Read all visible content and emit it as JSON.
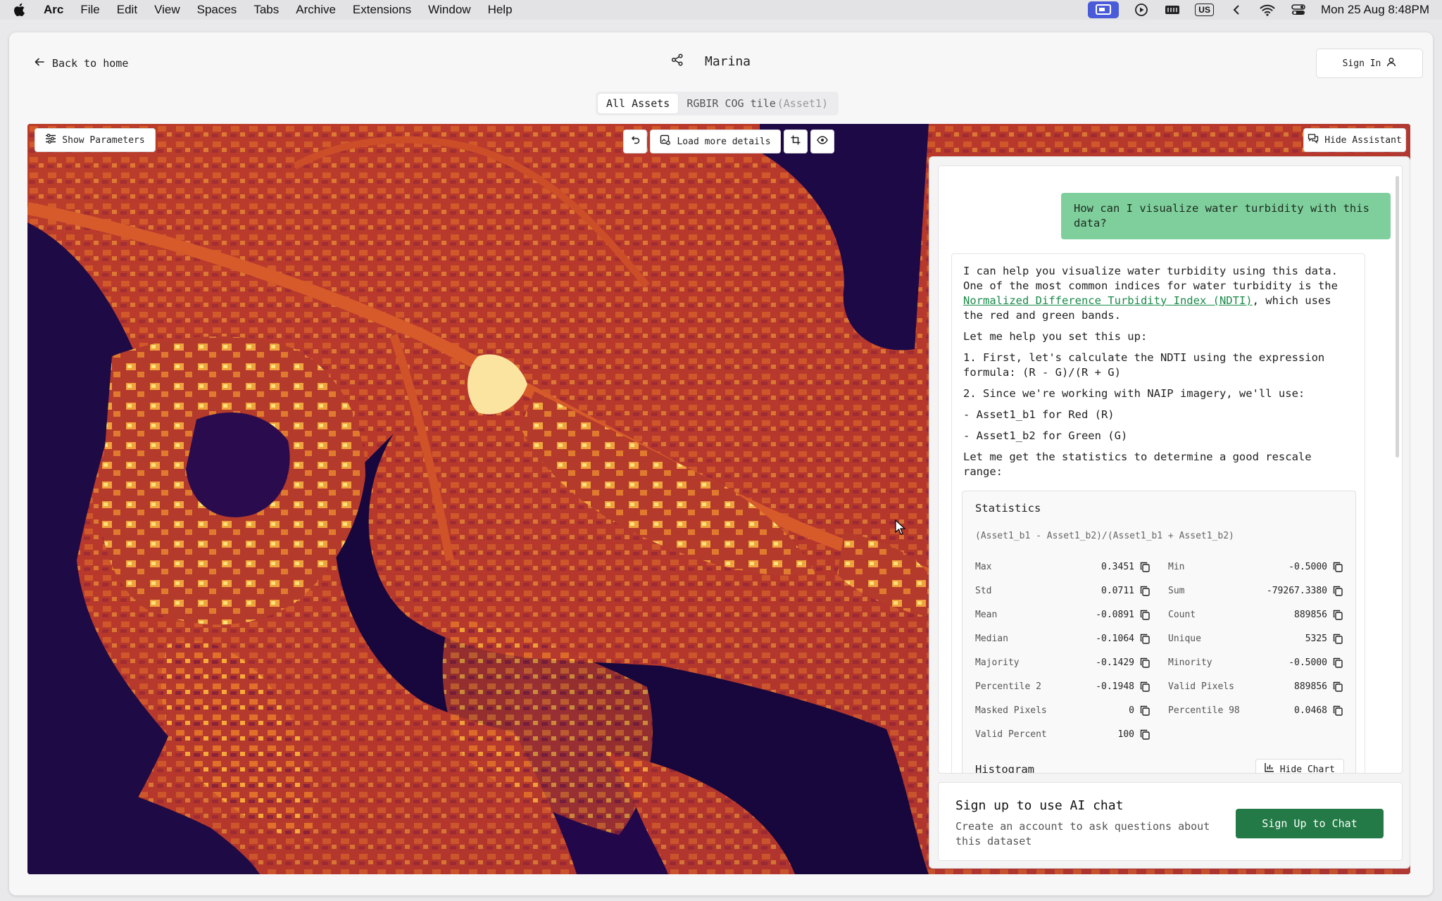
{
  "menubar": {
    "app_name": "Arc",
    "items": [
      "File",
      "Edit",
      "View",
      "Spaces",
      "Tabs",
      "Archive",
      "Extensions",
      "Window",
      "Help"
    ],
    "input_source": "US",
    "clock": "Mon 25 Aug  8:48PM"
  },
  "header": {
    "back_label": "Back to home",
    "title": "Marina",
    "sign_in_label": "Sign In"
  },
  "asset_tabs": {
    "all": "All Assets",
    "tile": "RGBIR COG tile",
    "tile_suffix": "(Asset1)"
  },
  "map_toolbar": {
    "show_parameters": "Show Parameters",
    "load_more": "Load more details",
    "hide_assistant": "Hide Assistant"
  },
  "chat": {
    "user_message": "How can I visualize water turbidity with this data?",
    "ai_intro_before_link": "I can help you visualize water turbidity using this data. One of the most common indices for water turbidity is the ",
    "ai_link": "Normalized Difference Turbidity Index (NDTI)",
    "ai_intro_after_link": ", which uses the red and green bands.",
    "ai_setup": "Let me help you set this up:",
    "ai_step1": "1. First, let's calculate the NDTI using the expression formula: (R - G)/(R + G)",
    "ai_step2": "2. Since we're working with NAIP imagery, we'll use:",
    "ai_band_red": "- Asset1_b1 for Red (R)",
    "ai_band_green": "- Asset1_b2 for Green (G)",
    "ai_stats_intro": "Let me get the statistics to determine a good rescale range:"
  },
  "statistics": {
    "title": "Statistics",
    "expression": "(Asset1_b1 - Asset1_b2)/(Asset1_b1 + Asset1_b2)",
    "rows": [
      {
        "label": "Max",
        "value": "0.3451"
      },
      {
        "label": "Min",
        "value": "-0.5000"
      },
      {
        "label": "Std",
        "value": "0.0711"
      },
      {
        "label": "Sum",
        "value": "-79267.3380"
      },
      {
        "label": "Mean",
        "value": "-0.0891"
      },
      {
        "label": "Count",
        "value": "889856"
      },
      {
        "label": "Median",
        "value": "-0.1064"
      },
      {
        "label": "Unique",
        "value": "5325"
      },
      {
        "label": "Majority",
        "value": "-0.1429"
      },
      {
        "label": "Minority",
        "value": "-0.5000"
      },
      {
        "label": "Percentile 2",
        "value": "-0.1948"
      },
      {
        "label": "Valid Pixels",
        "value": "889856"
      },
      {
        "label": "Masked Pixels",
        "value": "0"
      },
      {
        "label": "Percentile 98",
        "value": "0.0468"
      },
      {
        "label": "Valid Percent",
        "value": "100"
      }
    ],
    "histogram_title": "Histogram",
    "hide_chart_label": "Hide Chart"
  },
  "signup": {
    "title": "Sign up to use AI chat",
    "description": "Create an account to ask questions about this dataset",
    "button": "Sign Up to Chat"
  },
  "colors": {
    "accent_green": "#237a46",
    "user_bubble": "#7ecf9b",
    "link_green": "#1b8a4a"
  }
}
